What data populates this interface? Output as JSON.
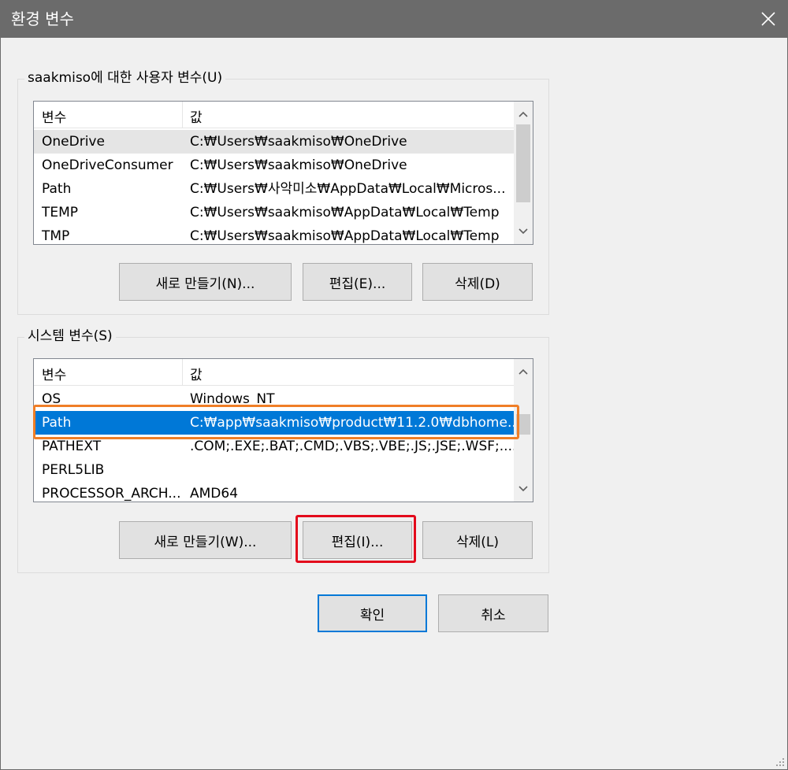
{
  "window": {
    "title": "환경 변수"
  },
  "user_vars": {
    "legend": "saakmiso에 대한 사용자 변수(U)",
    "header": {
      "name": "변수",
      "value": "값"
    },
    "rows": [
      {
        "name": "OneDrive",
        "value": "C:₩Users₩saakmiso₩OneDrive"
      },
      {
        "name": "OneDriveConsumer",
        "value": "C:₩Users₩saakmiso₩OneDrive"
      },
      {
        "name": "Path",
        "value": "C:₩Users₩사악미소₩AppData₩Local₩Micros..."
      },
      {
        "name": "TEMP",
        "value": "C:₩Users₩saakmiso₩AppData₩Local₩Temp"
      },
      {
        "name": "TMP",
        "value": "C:₩Users₩saakmiso₩AppData₩Local₩Temp"
      }
    ],
    "buttons": {
      "new": "새로 만들기(N)...",
      "edit": "편집(E)...",
      "delete": "삭제(D)"
    }
  },
  "system_vars": {
    "legend": "시스템 변수(S)",
    "header": {
      "name": "변수",
      "value": "값"
    },
    "rows": [
      {
        "name": "OS",
        "value": "Windows_NT"
      },
      {
        "name": "Path",
        "value": "C:₩app₩saakmiso₩product₩11.2.0₩dbhome..."
      },
      {
        "name": "PATHEXT",
        "value": ".COM;.EXE;.BAT;.CMD;.VBS;.VBE;.JS;.JSE;.WSF;...."
      },
      {
        "name": "PERL5LIB",
        "value": ""
      },
      {
        "name": "PROCESSOR_ARCH...",
        "value": "AMD64"
      }
    ],
    "selected_row": "Path",
    "buttons": {
      "new": "새로 만들기(W)...",
      "edit": "편집(I)...",
      "delete": "삭제(L)"
    }
  },
  "footer": {
    "ok": "확인",
    "cancel": "취소"
  },
  "icons": {
    "close": "close-icon",
    "scroll_up": "chevron-up-icon",
    "scroll_down": "chevron-down-icon",
    "resize": "resize-grip-icon"
  },
  "colors": {
    "titlebar": "#6b6b6b",
    "selection": "#0078d7",
    "highlight_orange": "#f07e26",
    "highlight_red": "#e3091b"
  }
}
